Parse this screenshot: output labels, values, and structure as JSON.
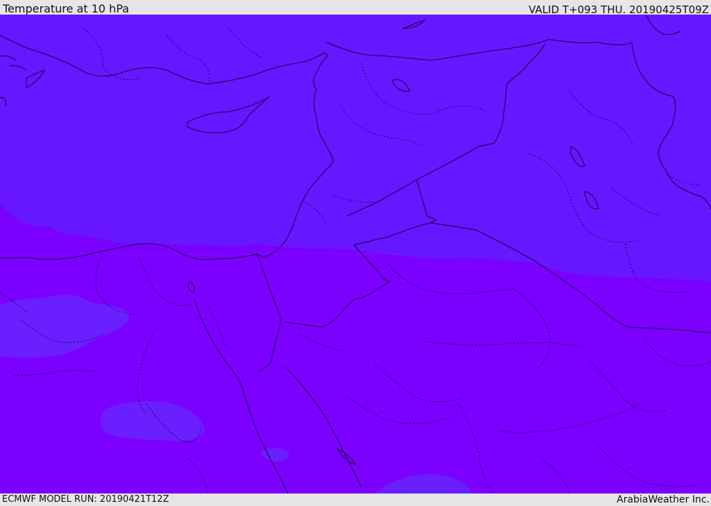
{
  "header": {
    "title": "Temperature at 10 hPa",
    "valid": "VALID T+093 THU. 20190425T09Z"
  },
  "footer": {
    "model_run": "ECMWF MODEL RUN: 20190421T12Z",
    "credit": "ArabiaWeather Inc."
  },
  "map": {
    "colors": {
      "warmer_band": "#7b00ff",
      "cooler_band": "#6617ff",
      "cool_patch": "#6a1fff",
      "coastline": "#1a0040",
      "border": "#1a0040"
    },
    "regions_depicted": [
      "Eastern Mediterranean",
      "Egypt",
      "Levant",
      "Iraq",
      "Saudi Arabia"
    ]
  }
}
